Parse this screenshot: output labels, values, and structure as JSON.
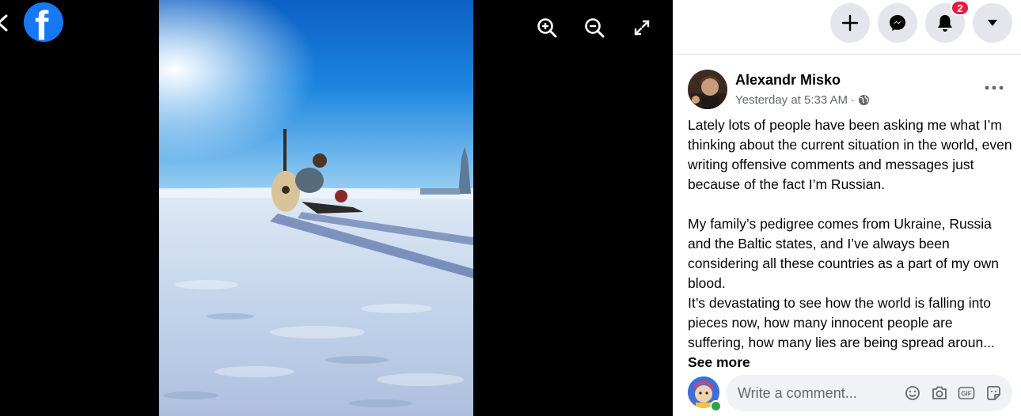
{
  "viewer": {
    "logo_letter": "f",
    "back_icon": "chevron-left-icon",
    "tools": [
      "zoom-in-icon",
      "zoom-out-icon",
      "fullscreen-icon"
    ]
  },
  "topbar": {
    "notifications_count": "2",
    "buttons": [
      "plus-icon",
      "messenger-icon",
      "bell-icon",
      "caret-down-icon"
    ]
  },
  "post": {
    "author": "Alexandr Misko",
    "timestamp": "Yesterday at 5:33 AM",
    "separator": "·",
    "audience_icon": "globe-icon",
    "paragraph1": "Lately lots of people have been asking me what I’m thinking about the current situation in the world, even writing offensive comments and messages just because of the fact I’m Russian.",
    "paragraph2": "My family’s pedigree comes from Ukraine, Russia and the Baltic states, and I’ve always been considering all these countries as a part of my own blood.",
    "paragraph3": "It’s devastating to see how the world is falling into pieces now, how many innocent people are suffering, how many lies are being spread aroun...",
    "see_more": "See more"
  },
  "comment": {
    "placeholder": "Write a comment...",
    "icons": [
      "emoji-icon",
      "camera-icon",
      "gif-icon",
      "sticker-icon"
    ]
  },
  "colors": {
    "facebook_blue": "#1877f2",
    "badge_red": "#e41e3f",
    "online_green": "#31a24c"
  }
}
